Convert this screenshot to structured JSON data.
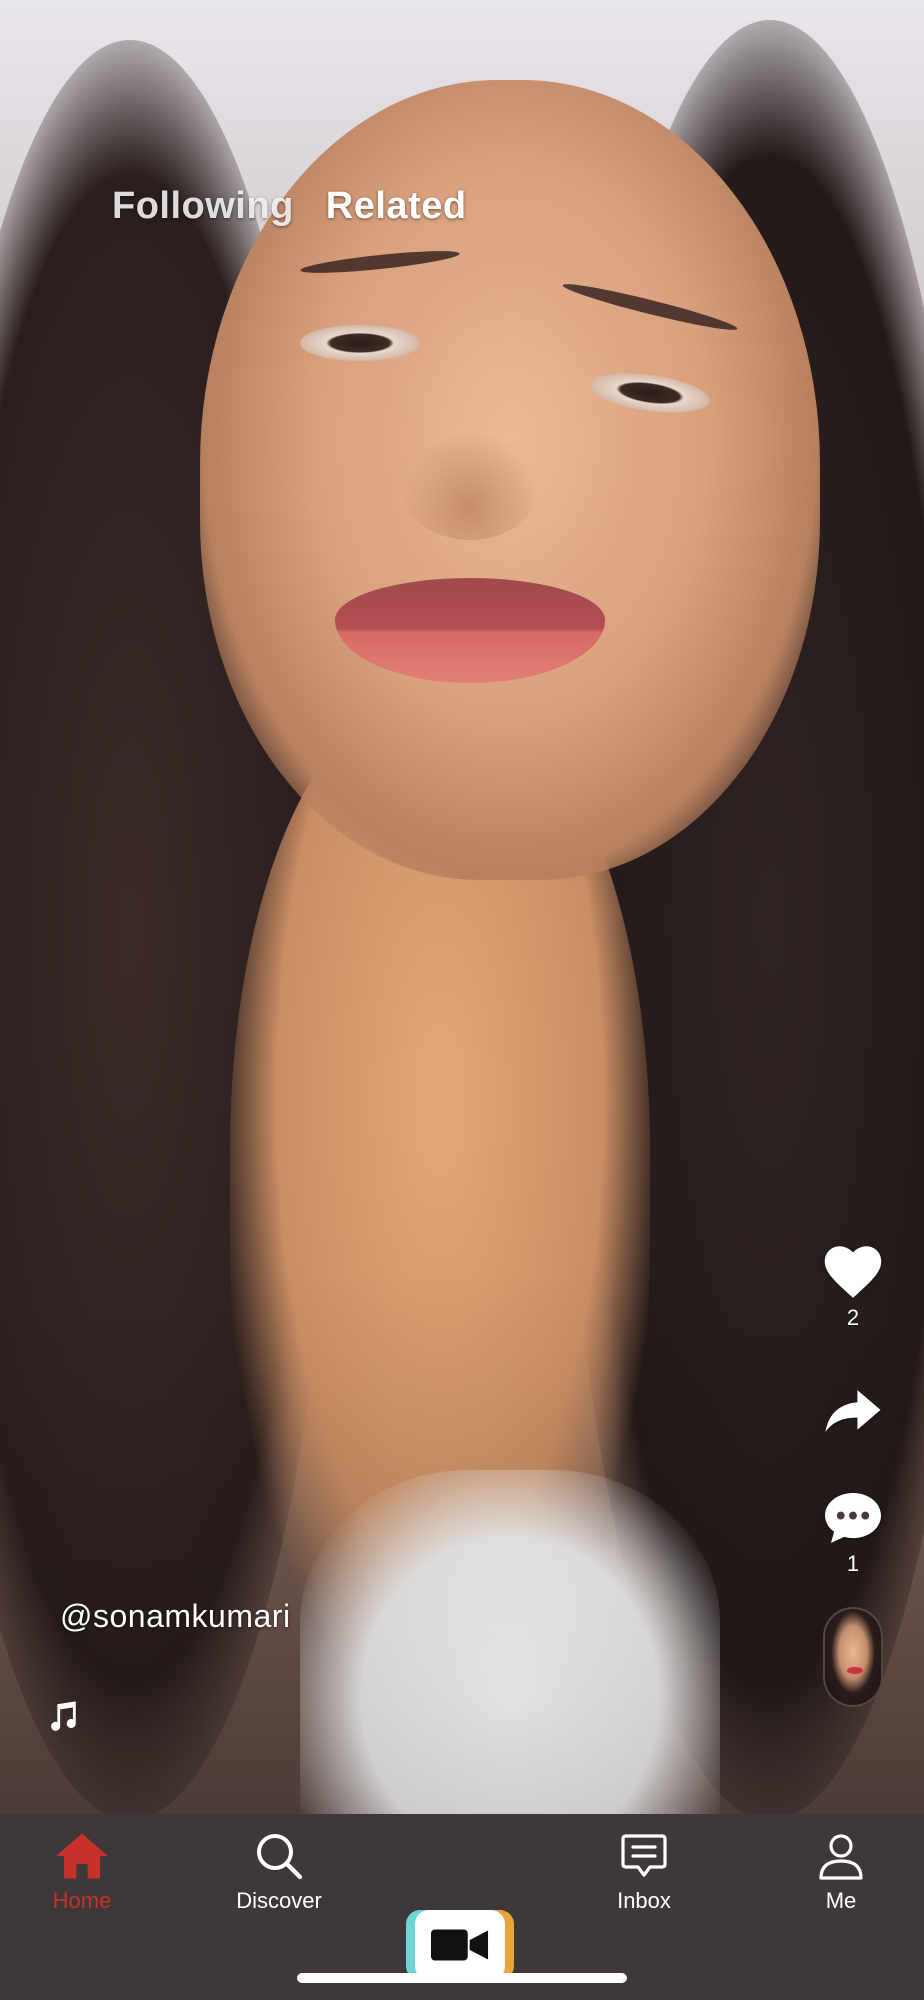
{
  "top_tabs": [
    {
      "label": "Following",
      "active": false
    },
    {
      "label": "Related",
      "active": true
    }
  ],
  "video": {
    "username": "@sonamkumari",
    "music_icon": "music-note-icon"
  },
  "actions": {
    "like": {
      "icon": "heart-icon",
      "count": "2"
    },
    "share": {
      "icon": "share-arrow-icon"
    },
    "comment": {
      "icon": "comment-bubble-icon",
      "count": "1"
    },
    "profile": {
      "icon": "creator-avatar"
    }
  },
  "bottom_nav": {
    "home": {
      "label": "Home",
      "icon": "home-icon",
      "active": true
    },
    "discover": {
      "label": "Discover",
      "icon": "search-icon"
    },
    "record": {
      "icon": "video-camera-icon"
    },
    "inbox": {
      "label": "Inbox",
      "icon": "message-icon"
    },
    "me": {
      "label": "Me",
      "icon": "user-icon"
    }
  },
  "colors": {
    "nav_background": "#3e3838",
    "active_accent": "#c8312a",
    "record_left": "#6fd6d8",
    "record_right": "#e9a43b"
  }
}
